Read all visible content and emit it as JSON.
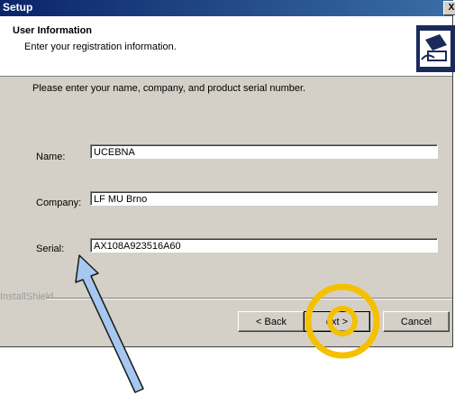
{
  "window": {
    "title": "Setup",
    "close_symbol": "X"
  },
  "header": {
    "title": "User Information",
    "subtitle": "Enter your registration information.",
    "logo_icon": "installer-computer-icon"
  },
  "body": {
    "intro": "Please enter your name, company, and product serial number.",
    "fields": [
      {
        "label": "Name:",
        "value": "UCEBNA"
      },
      {
        "label": "Company:",
        "value": "LF MU Brno"
      },
      {
        "label": "Serial:",
        "value": "AX108A923516A60"
      }
    ]
  },
  "footer": {
    "brand": "InstallShield",
    "back_label": "< Back",
    "next_label": "ext >",
    "cancel_label": "Cancel"
  },
  "annotations": {
    "arrow_color": "#a6c8f0",
    "circle_color": "#f5c000",
    "arrow_icon": "pointer-arrow-annotation",
    "circle_icon": "highlight-ring-annotation"
  }
}
